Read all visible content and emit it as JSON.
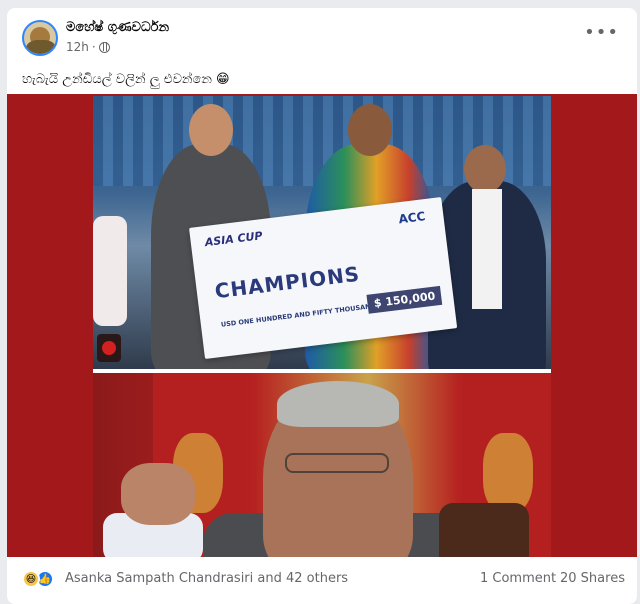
{
  "post": {
    "author": "මහේෂ් ගුණවර්ධන",
    "time": "12h",
    "privacy_icon": "globe-icon",
    "more_icon": "more-options-icon",
    "caption": "හැබැයි උන්ඩියල් වලින් ලු එවන්නෙ 😁"
  },
  "media": {
    "cheque": {
      "cup_text": "ASIA CUP",
      "org_text": "ACC",
      "headline": "CHAMPIONS",
      "amount_words": "USD ONE HUNDRED AND FIFTY THOUSAND",
      "amount": "$ 150,000"
    }
  },
  "footer": {
    "reaction_icons": [
      "haha-icon",
      "like-icon"
    ],
    "reactions_text": "Asanka Sampath Chandrasiri and 42 others",
    "comments": "1 Comment",
    "shares": "20 Shares"
  },
  "colors": {
    "accent": "#1877f2",
    "media_background": "#a3191b",
    "meta_text": "#65676b"
  }
}
